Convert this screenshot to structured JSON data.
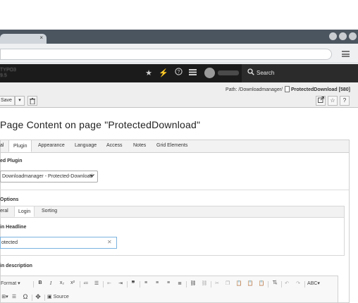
{
  "browser": {
    "tab_close": "×"
  },
  "topbar": {
    "logo_text_1": "TYPO3",
    "logo_text_2": "9.5",
    "search_label": "Search",
    "icons": [
      "star-icon",
      "bolt-icon",
      "help-icon",
      "list-icon",
      "user-icon",
      "search-icon"
    ]
  },
  "docheader": {
    "path_prefix": "Path: /Downloadmanager/",
    "page_title": "ProtectedDownload [580]",
    "save_label": "Save"
  },
  "page": {
    "heading": "Page Content on page \"ProtectedDownload\""
  },
  "main_tabs": [
    "al",
    "Plugin",
    "Appearance",
    "Language",
    "Access",
    "Notes",
    "Grid Elements"
  ],
  "plugin": {
    "selected_plugin_label": "ed Plugin",
    "plugin_select_value": "Downloadmanager - Protected-Download",
    "options_label": "Options"
  },
  "sub_tabs": [
    "eral",
    "Login",
    "Sorting"
  ],
  "login": {
    "headline_label": "in Headline",
    "headline_value": "otected",
    "description_label": "in description"
  },
  "editor": {
    "format_label": "Format",
    "source_label": "Source"
  }
}
